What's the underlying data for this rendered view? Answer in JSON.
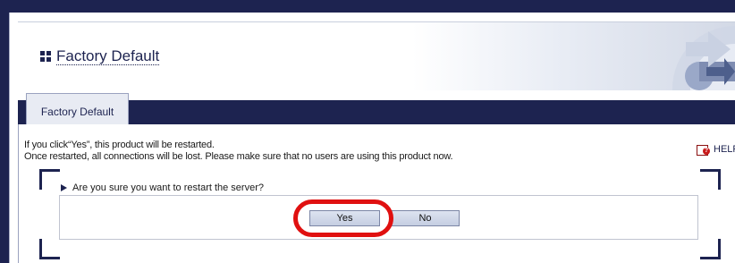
{
  "header": {
    "title": "Factory Default"
  },
  "tab": {
    "label": "Factory Default"
  },
  "message": {
    "line1": "If you click“Yes”, this product will be restarted.",
    "line2": "Once restarted, all connections will be lost. Please make sure that no users are using this product now."
  },
  "help": {
    "label": "HELP",
    "icon": "help-book-icon"
  },
  "dialog": {
    "question": "Are you sure you want to restart the server?",
    "yes_label": "Yes",
    "no_label": "No"
  },
  "colors": {
    "frame": "#1d2350",
    "highlight": "#e01010",
    "button": "#c5cee2"
  }
}
